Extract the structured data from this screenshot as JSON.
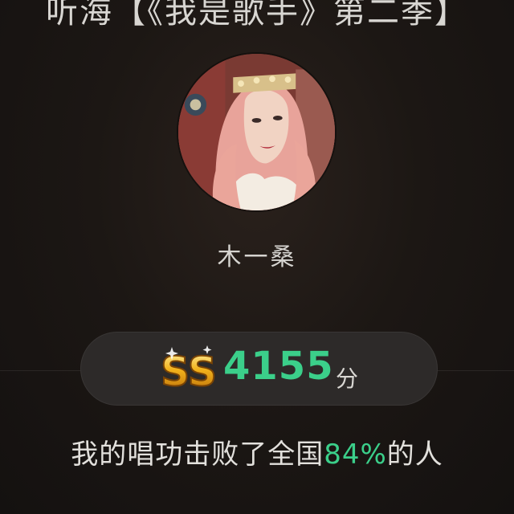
{
  "header": {
    "title": "听海【《我是歌手》第二季】"
  },
  "profile": {
    "name": "木一桑"
  },
  "score": {
    "grade": "SS",
    "value": "4155",
    "unit": "分"
  },
  "result": {
    "prefix": "我的唱功击败了全国",
    "percent": "84%",
    "suffix": "的人"
  },
  "colors": {
    "accent_green": "#3bcf8a",
    "background": "#1c1714",
    "pill": "#2d2a29",
    "badge_gold": "#f2b21c"
  }
}
